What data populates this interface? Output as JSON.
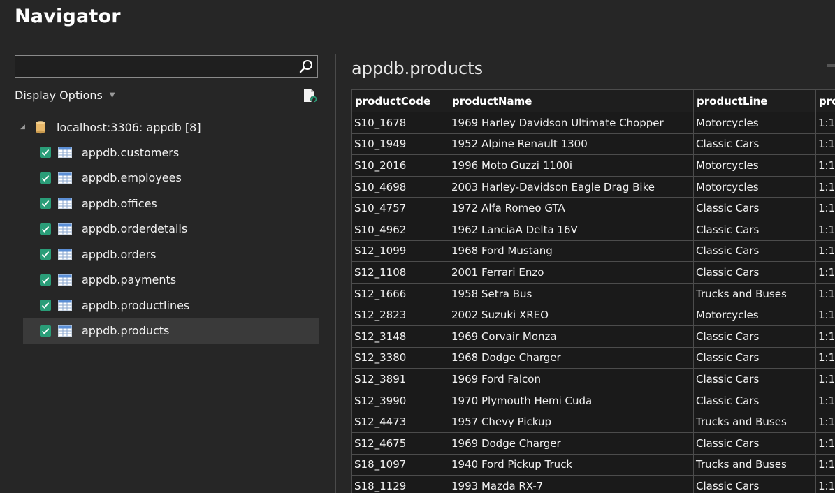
{
  "window": {
    "title": "Navigator"
  },
  "search": {
    "value": "",
    "placeholder": ""
  },
  "display_options": {
    "label": "Display Options"
  },
  "tree": {
    "root_label": "localhost:3306: appdb [8]",
    "items": [
      {
        "label": "appdb.customers",
        "checked": true
      },
      {
        "label": "appdb.employees",
        "checked": true
      },
      {
        "label": "appdb.offices",
        "checked": true
      },
      {
        "label": "appdb.orderdetails",
        "checked": true
      },
      {
        "label": "appdb.orders",
        "checked": true
      },
      {
        "label": "appdb.payments",
        "checked": true
      },
      {
        "label": "appdb.productlines",
        "checked": true
      },
      {
        "label": "appdb.products",
        "checked": true,
        "selected": true
      }
    ]
  },
  "preview": {
    "title": "appdb.products",
    "columns": [
      "productCode",
      "productName",
      "productLine",
      "pro"
    ],
    "rows": [
      [
        "S10_1678",
        "1969 Harley Davidson Ultimate Chopper",
        "Motorcycles",
        "1:1"
      ],
      [
        "S10_1949",
        "1952 Alpine Renault 1300",
        "Classic Cars",
        "1:1"
      ],
      [
        "S10_2016",
        "1996 Moto Guzzi 1100i",
        "Motorcycles",
        "1:1"
      ],
      [
        "S10_4698",
        "2003 Harley-Davidson Eagle Drag Bike",
        "Motorcycles",
        "1:1"
      ],
      [
        "S10_4757",
        "1972 Alfa Romeo GTA",
        "Classic Cars",
        "1:1"
      ],
      [
        "S10_4962",
        "1962 LanciaA Delta 16V",
        "Classic Cars",
        "1:1"
      ],
      [
        "S12_1099",
        "1968 Ford Mustang",
        "Classic Cars",
        "1:1"
      ],
      [
        "S12_1108",
        "2001 Ferrari Enzo",
        "Classic Cars",
        "1:1"
      ],
      [
        "S12_1666",
        "1958 Setra Bus",
        "Trucks and Buses",
        "1:1"
      ],
      [
        "S12_2823",
        "2002 Suzuki XREO",
        "Motorcycles",
        "1:1"
      ],
      [
        "S12_3148",
        "1969 Corvair Monza",
        "Classic Cars",
        "1:1"
      ],
      [
        "S12_3380",
        "1968 Dodge Charger",
        "Classic Cars",
        "1:1"
      ],
      [
        "S12_3891",
        "1969 Ford Falcon",
        "Classic Cars",
        "1:1"
      ],
      [
        "S12_3990",
        "1970 Plymouth Hemi Cuda",
        "Classic Cars",
        "1:1"
      ],
      [
        "S12_4473",
        "1957 Chevy Pickup",
        "Trucks and Buses",
        "1:1"
      ],
      [
        "S12_4675",
        "1969 Dodge Charger",
        "Classic Cars",
        "1:1"
      ],
      [
        "S18_1097",
        "1940 Ford Pickup Truck",
        "Trucks and Buses",
        "1:1"
      ],
      [
        "S18_1129",
        "1993 Mazda RX-7",
        "Classic Cars",
        "1:1"
      ]
    ]
  },
  "colors": {
    "background": "#262626",
    "checkbox": "#2a9d78",
    "selected_row": "#3a3a3a",
    "grid_border": "#4c4c4c"
  },
  "icons": {
    "search": "search-icon",
    "refresh": "refresh-file-icon",
    "database": "database-icon",
    "table": "table-icon"
  }
}
